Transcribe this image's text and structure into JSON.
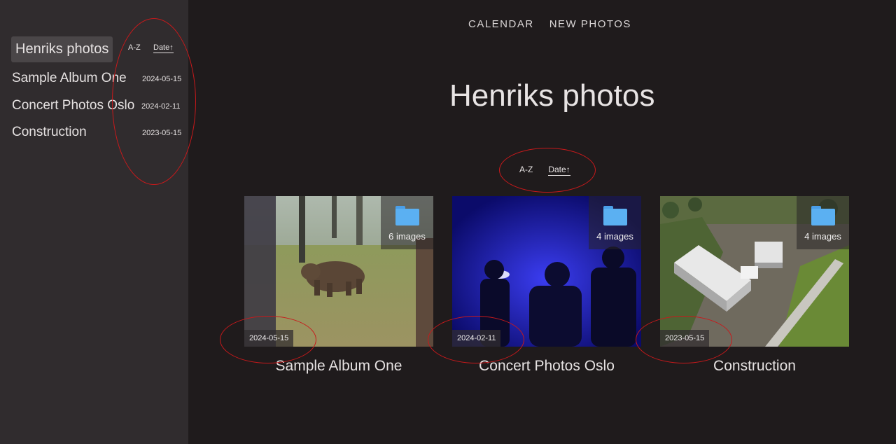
{
  "sidebar": {
    "title": "Henriks photos",
    "sort_az": "A-Z",
    "sort_date": "Date↑",
    "albums": [
      {
        "name": "Sample Album One",
        "date": "2024-05-15"
      },
      {
        "name": "Concert Photos Oslo",
        "date": "2024-02-11"
      },
      {
        "name": "Construction",
        "date": "2023-05-15"
      }
    ]
  },
  "nav": {
    "calendar": "CALENDAR",
    "new_photos": "NEW PHOTOS"
  },
  "main": {
    "title": "Henriks photos",
    "sort_az": "A-Z",
    "sort_date": "Date↑",
    "albums": [
      {
        "name": "Sample Album One",
        "count": "6 images",
        "date": "2024-05-15"
      },
      {
        "name": "Concert Photos Oslo",
        "count": "4 images",
        "date": "2024-02-11"
      },
      {
        "name": "Construction",
        "count": "4 images",
        "date": "2023-05-15"
      }
    ]
  },
  "colors": {
    "accent_annotation": "#c8191b",
    "folder": "#5bb0f2",
    "background": "#1f1b1c",
    "sidebar": "#302c2e"
  }
}
